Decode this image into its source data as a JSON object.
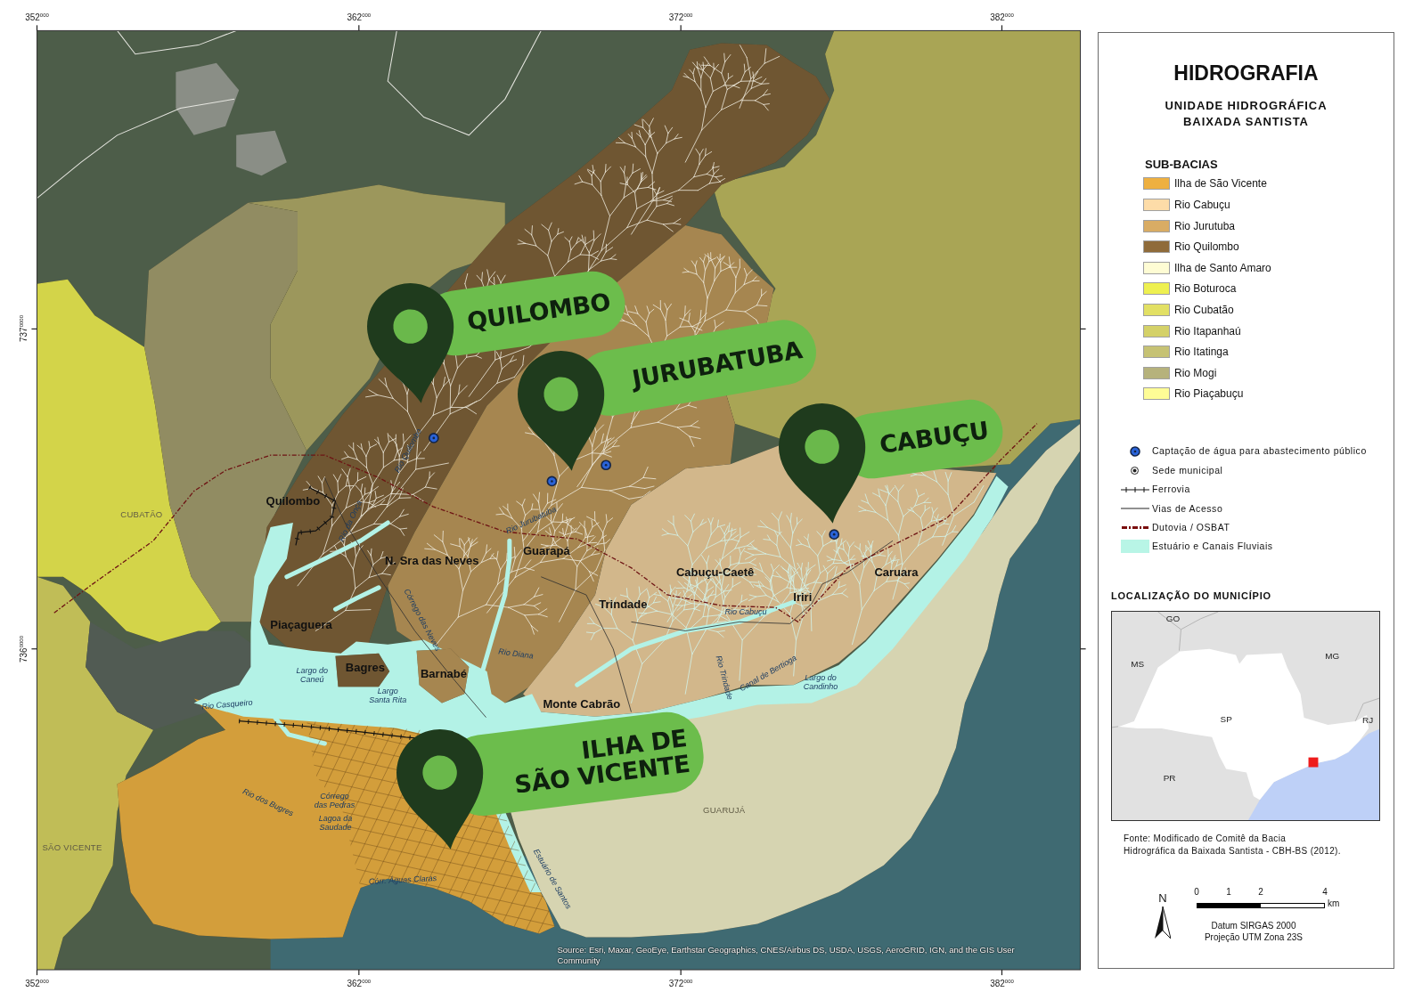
{
  "map": {
    "grid_labels": {
      "top": [
        "352$^{000}$",
        "362$^{000}$",
        "372$^{000}$",
        "382$^{000}$"
      ],
      "left": [
        "737$^{0000}$",
        "736$^{0000}$"
      ],
      "bottom": [
        "352$^{000}$",
        "362$^{000}$",
        "372$^{000}$",
        "382$^{000}$"
      ]
    },
    "municipality_labels": [
      "CUBATÃO",
      "SÃO VICENTE",
      "GUARUJÁ"
    ],
    "locality_labels": [
      "Quilombo",
      "N. Sra das Neves",
      "Guarapá",
      "Piaçaguera",
      "Bagres",
      "Barnabé",
      "Trindade",
      "Cabuçu-Caetê",
      "Iriri",
      "Caruara",
      "Monte Cabrão"
    ],
    "water_labels": [
      {
        "lines": [
          "Rio Quilombo"
        ]
      },
      {
        "lines": [
          "Rio da Onça"
        ]
      },
      {
        "lines": [
          "Córrego das Neves"
        ]
      },
      {
        "lines": [
          "Rio Jurubatuba"
        ]
      },
      {
        "lines": [
          "Rio Diana"
        ]
      },
      {
        "lines": [
          "Largo do",
          "Caneú"
        ]
      },
      {
        "lines": [
          "Largo",
          "Santa Rita"
        ]
      },
      {
        "lines": [
          "Rio Casqueiro"
        ]
      },
      {
        "lines": [
          "Rio Cabuçu"
        ]
      },
      {
        "lines": [
          "Rio Trindade"
        ]
      },
      {
        "lines": [
          "Canal de Bertioga"
        ]
      },
      {
        "lines": [
          "Largo do",
          "Candinho"
        ]
      },
      {
        "lines": [
          "Rio dos Bugres"
        ]
      },
      {
        "lines": [
          "Córrego",
          "das Pedras"
        ]
      },
      {
        "lines": [
          "Lagoa da",
          "Saudade"
        ]
      },
      {
        "lines": [
          "Córr. Águas Claras"
        ]
      },
      {
        "lines": [
          "Estuário de Santos"
        ]
      }
    ],
    "callouts": [
      {
        "lines": [
          "QUILOMBO"
        ]
      },
      {
        "lines": [
          "JURUBATUBA"
        ]
      },
      {
        "lines": [
          "CABUÇU"
        ]
      },
      {
        "lines": [
          "ILHA DE",
          "SÃO VICENTE"
        ]
      }
    ],
    "attribution": [
      "Source: Esri, Maxar, GeoEye, Earthstar Geographics, CNES/Airbus DS, USDA, USGS, AeroGRID, IGN, and the GIS User",
      "Community"
    ]
  },
  "legend": {
    "title": "HIDROGRAFIA",
    "subtitle": [
      "UNIDADE HIDROGRÁFICA",
      "BAIXADA SANTISTA"
    ],
    "sub_basins": {
      "heading": "SUB-BACIAS",
      "items": [
        {
          "label": "Ilha de São Vicente",
          "color": "#eeb040"
        },
        {
          "label": "Rio Cabuçu",
          "color": "#fddca8"
        },
        {
          "label": "Rio Jurutuba",
          "color": "#d9ac64"
        },
        {
          "label": "Rio Quilombo",
          "color": "#8f6b3a"
        },
        {
          "label": "Ilha de Santo Amaro",
          "color": "#fefcd4"
        },
        {
          "label": "Rio Boturoca",
          "color": "#eef050"
        },
        {
          "label": "Rio Cubatão",
          "color": "#e2e064"
        },
        {
          "label": "Rio Itapanhaú",
          "color": "#d4d168"
        },
        {
          "label": "Rio Itatinga",
          "color": "#c6c274"
        },
        {
          "label": "Rio Mogi",
          "color": "#b6b27c"
        },
        {
          "label": "Rio Piaçabuçu",
          "color": "#fefc96"
        }
      ]
    },
    "symbols": [
      {
        "kind": "intake",
        "label": "Captação de água para abastecimento público"
      },
      {
        "kind": "seat",
        "label": "Sede municipal"
      },
      {
        "kind": "railway",
        "label": "Ferrovia"
      },
      {
        "kind": "road",
        "label": "Vias de Acesso"
      },
      {
        "kind": "pipeline",
        "label": "Dutovia / OSBAT"
      },
      {
        "kind": "water",
        "label": "Estuário e Canais Fluviais"
      }
    ],
    "locator": {
      "heading": "LOCALIZAÇÃO DO MUNICÍPIO",
      "state_labels": [
        "GO",
        "MS",
        "MG",
        "SP",
        "RJ",
        "PR"
      ]
    },
    "source": [
      "Fonte: Modificado de Comitê da Bacia",
      "Hidrográfica da Baixada Santista - CBH-BS (2012)."
    ],
    "scale": {
      "ticks": [
        "0",
        "1",
        "2",
        "4"
      ],
      "unit": "km"
    },
    "north": "N",
    "datum": [
      "Datum SIRGAS 2000",
      "Projeção UTM Zona 23S"
    ]
  }
}
